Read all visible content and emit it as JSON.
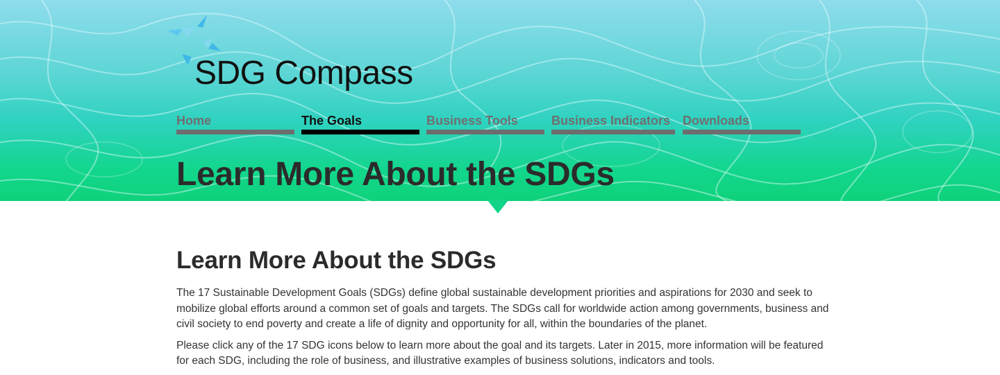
{
  "brand": {
    "name": "SDG Compass",
    "logo_icon": "compass-arrows-icon",
    "accent": "#3fb8e8"
  },
  "nav": {
    "items": [
      {
        "label": "Home",
        "active": false
      },
      {
        "label": "The Goals",
        "active": true
      },
      {
        "label": "Business Tools",
        "active": false
      },
      {
        "label": "Business Indicators",
        "active": false
      },
      {
        "label": "Downloads",
        "active": false
      }
    ]
  },
  "hero": {
    "title": "Learn More About the SDGs",
    "colors": {
      "top": "#8fdcec",
      "bottom": "#0fd27a"
    }
  },
  "content": {
    "heading": "Learn More About the SDGs",
    "paragraphs": [
      "The 17 Sustainable Development Goals (SDGs) define global sustainable development priorities and aspirations for 2030 and seek to mobilize global efforts around a common set of goals and targets. The SDGs call for worldwide action among governments, business and civil society to end poverty and create a life of dignity and opportunity for all, within the boundaries of the planet.",
      "Please click any of the 17 SDG icons below to learn more about the goal and its targets. Later in 2015, more information will be featured for each SDG, including the role of business, and illustrative examples of business solutions, indicators and tools."
    ]
  }
}
